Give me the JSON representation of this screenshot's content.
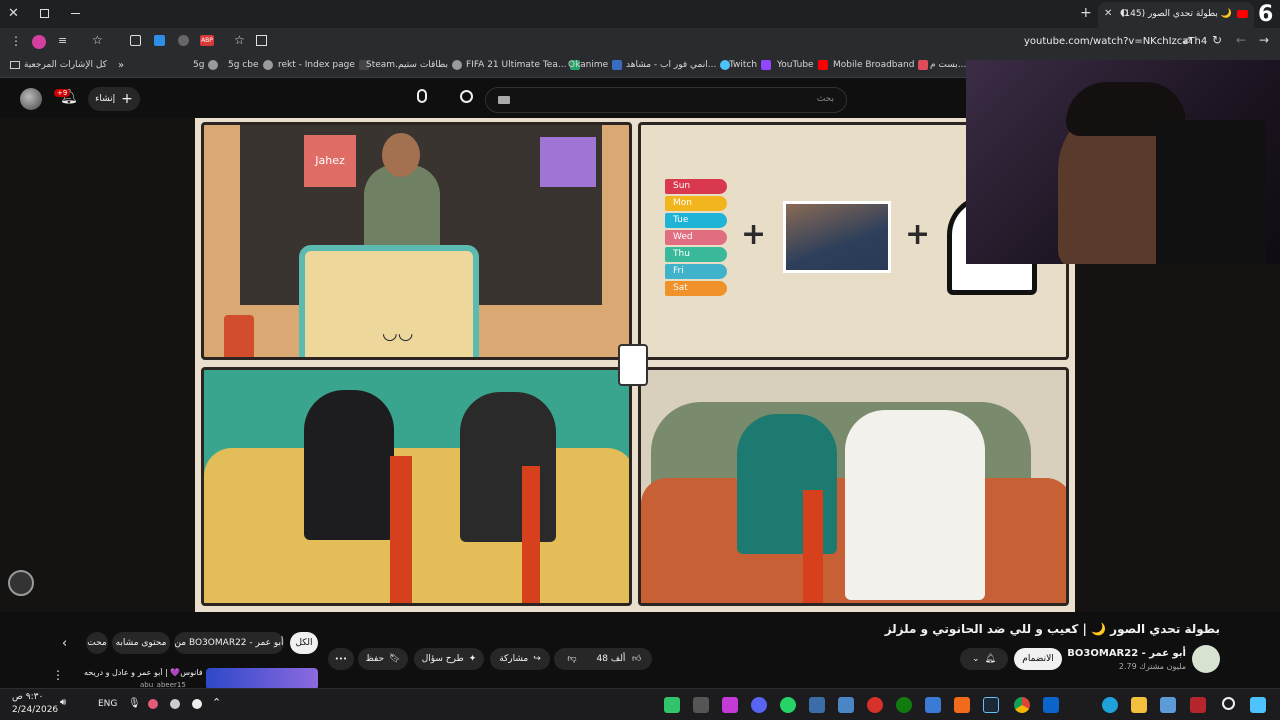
{
  "browser": {
    "tab_title": "(145) بطولة تحدي الصور 🌙",
    "url": "youtube.com/watch?v=NKchIzcaTh4",
    "corner_badge": "6",
    "bookmarks": [
      {
        "label": "كل الإشارات المرجعية",
        "color": "#cfcfcf"
      },
      {
        "label": "5g",
        "color": "#9a9a9a"
      },
      {
        "label": "5g cbe",
        "color": "#9a9a9a"
      },
      {
        "label": "rekt - Index page",
        "color": "#9a9a9a"
      },
      {
        "label": "Steam...",
        "color": "#1b2838"
      },
      {
        "label": "بطاقات ستيم",
        "color": "#9a9a9a"
      },
      {
        "label": "FIFA 21 Ultimate Tea...",
        "color": "#26a269"
      },
      {
        "label": "Okanime",
        "color": "#3a6cc2"
      },
      {
        "label": "انمي فور اب - مشاهد...",
        "color": "#4fc3f7"
      },
      {
        "label": "Twitch",
        "color": "#9146ff"
      },
      {
        "label": "YouTube",
        "color": "#ff0000"
      },
      {
        "label": "Mobile Broadband",
        "color": "#e04b5a"
      },
      {
        "label": "بست م...",
        "color": "#9a9a9a"
      }
    ]
  },
  "youtube": {
    "search_placeholder": "بحث",
    "create_label": "إنشاء",
    "notif_count": "+9",
    "days": [
      "Sun",
      "Mon",
      "Tue",
      "Wed",
      "Thu",
      "Fri",
      "Sat"
    ],
    "day_colors": [
      "#d9384f",
      "#f2b51d",
      "#1fb3d8",
      "#e06d80",
      "#39b89a",
      "#40b2c9",
      "#f0912a"
    ],
    "plus": "+",
    "studio_sign": "Jahez",
    "video_title": "بطولة تحدي الصور 🌙 | كعيب و للي ضد الحانوتي و ملزلز",
    "channel_name": "BO3OMAR22 - أبو عمر",
    "subscribers": "2.79 مليون مشترك",
    "join_label": "الانضمام",
    "likes": "48 ألف",
    "share_label": "مشاركة",
    "ask_label": "طرح سؤال",
    "save_label": "حفظ",
    "more_label": "•••",
    "chips": [
      "الكل",
      "من BO3OMAR22 - أبو عمر",
      "محتوى مشابه",
      "محت"
    ],
    "rec_title": "فانوس💜 | أبو عمر و عادل و دريحه",
    "rec_channel": "abu_abeer15"
  },
  "taskbar": {
    "time": "٩:٣٠ ص",
    "date": "2/24/2026",
    "lang": "ENG"
  }
}
